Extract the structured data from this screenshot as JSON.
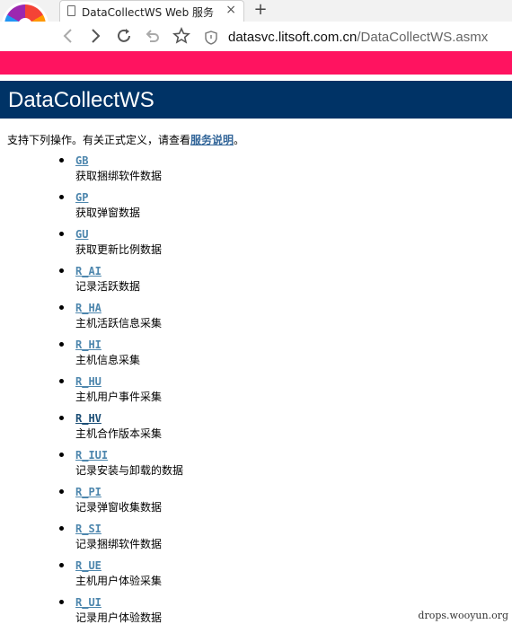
{
  "browser": {
    "tab_title": "DataCollectWS Web 服务",
    "tab_close": "×",
    "new_tab": "+",
    "address_host": "datasvc.litsoft.com.cn",
    "address_path": "/DataCollectWS.asmx",
    "icons": [
      "back-icon",
      "forward-icon",
      "reload-icon",
      "undo-icon",
      "star-icon",
      "shield-icon"
    ]
  },
  "page": {
    "heading": "DataCollectWS",
    "intro_prefix": "支持下列操作。有关正式定义，请查看",
    "intro_link": "服务说明",
    "intro_suffix": "。",
    "operations": [
      {
        "name": "GB",
        "desc": "获取捆绑软件数据"
      },
      {
        "name": "GP",
        "desc": "获取弹窗数据"
      },
      {
        "name": "GU",
        "desc": "获取更新比例数据"
      },
      {
        "name": "R_AI",
        "desc": "记录活跃数据"
      },
      {
        "name": "R_HA",
        "desc": "主机活跃信息采集"
      },
      {
        "name": "R_HI",
        "desc": "主机信息采集"
      },
      {
        "name": "R_HU",
        "desc": "主机用户事件采集"
      },
      {
        "name": "R_HV",
        "desc": "主机合作版本采集"
      },
      {
        "name": "R_IUI",
        "desc": "记录安装与卸载的数据"
      },
      {
        "name": "R_PI",
        "desc": "记录弹窗收集数据"
      },
      {
        "name": "R_SI",
        "desc": "记录捆绑软件数据"
      },
      {
        "name": "R_UE",
        "desc": "主机用户体验采集"
      },
      {
        "name": "R_UI",
        "desc": "记录用户体验数据"
      }
    ]
  },
  "watermark": "drops.wooyun.org",
  "colors": {
    "heading_bg": "#003366",
    "link": "#4d86ad",
    "link_visited": "#1a4d75",
    "banner": "#ff1360"
  }
}
